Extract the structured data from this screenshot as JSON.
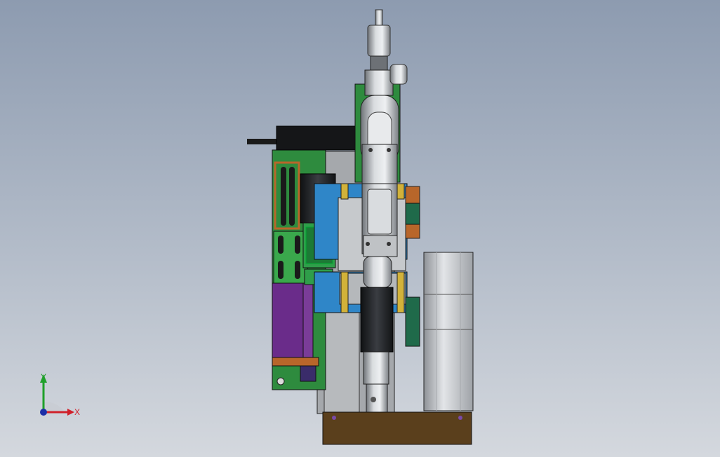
{
  "viewport": {
    "background_top": "#8d9bb0",
    "background_bottom": "#d4d8de"
  },
  "triad": {
    "x_label": "X",
    "y_label": "Y",
    "x_color": "#d0202a",
    "y_color": "#1fa02a",
    "origin_color": "#1c2fa8"
  },
  "colors": {
    "green_plate": "#2e8b3e",
    "blue_block": "#2f86c8",
    "purple_plate": "#6a2c8a",
    "gray_body": "#9a9ea3",
    "dark_part": "#1d1f22",
    "orange_part": "#b8662a",
    "base_block": "#5a3f1c"
  },
  "parts": {
    "icons": [
      "screwdriver-motor-icon",
      "servo-motor-icon",
      "base-block-icon"
    ]
  }
}
